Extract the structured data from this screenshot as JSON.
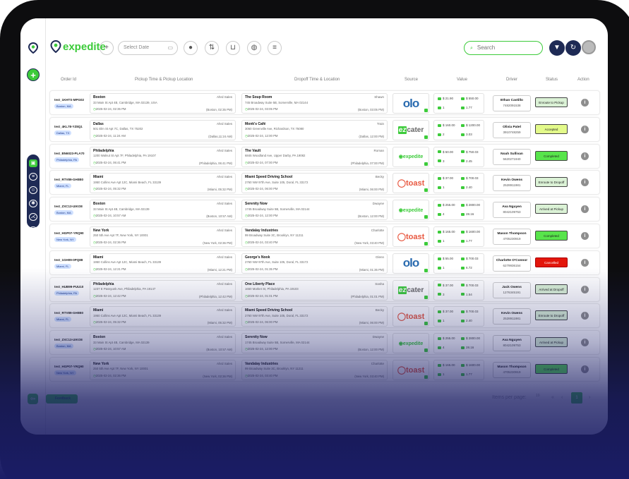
{
  "brand": {
    "name": "expedite"
  },
  "toolbar": {
    "date_placeholder": "Select Date",
    "search_placeholder": "Search"
  },
  "columns": [
    "Order Id",
    "Pickup Time & Pickup Location",
    "Dropoff Time & Location",
    "Source",
    "Value",
    "Driver",
    "Status",
    "Action"
  ],
  "orders": [
    {
      "order_id": "test_1KHTS-MPG02",
      "city": "Boston, MA",
      "pickup": {
        "name": "Boston",
        "who": "Ahrd Sales",
        "address": "33 Main St Apt 4B, Cambridge, MA 02139, USA",
        "time": "2025-02-24, 02:35 PM",
        "local": "(Boston, 02:35 PM)"
      },
      "dropoff": {
        "name": "The Soup Room",
        "who": "Shawn",
        "address": "745 Broadway Suite 5B, Somerville, MA 02144",
        "time": "2025-02-24, 03:05 PM",
        "local": "(Boston, 03:05 PM)"
      },
      "source": "olo",
      "value": {
        "a": "$ 21.90",
        "b": "$ 550.00",
        "c": "1",
        "d": "1.77"
      },
      "driver": {
        "name": "Ethan Castillo",
        "phone": "7482091538"
      },
      "status": "Enroute to Pickup",
      "status_class": "st-enroute"
    },
    {
      "order_id": "test_4KL78-YZ8Q1",
      "city": "Dallas, TX",
      "pickup": {
        "name": "Dallas",
        "who": "Ahrd Sales",
        "address": "501 Elm St Apt 7C, Dallas, TX 75202",
        "time": "2025-02-24, 11:24 AM",
        "local": "(Dallas,11:24 AM)"
      },
      "dropoff": {
        "name": "Monk's Café",
        "who": "Train",
        "address": "3060 Greenville Ave, Richardson, TX 75080",
        "time": "2025-02-24, 12:00 PM",
        "local": "(Dallas, 12:00 PM)"
      },
      "source": "ezcater",
      "value": {
        "a": "$ 160.00",
        "b": "$ 1200.00",
        "c": "2",
        "d": "3.03"
      },
      "driver": {
        "name": "Olivia Patel",
        "phone": "3910748259"
      },
      "status": "Accepted",
      "status_class": "st-accepted"
    },
    {
      "order_id": "test_BN6023-PLA70",
      "city": "Philadelphia, PA",
      "pickup": {
        "name": "Philadelphia",
        "who": "Ahrd Sales",
        "address": "1200 Walnut St Apt 7F, Philadelphia, PA 19107",
        "time": "2025-02-24, 06:41 PM",
        "local": "(Philadelphia, 06:41 PM)"
      },
      "dropoff": {
        "name": "The Vault",
        "who": "Roman",
        "address": "6845 Woodland Ave, Upper Darby, PA 19082",
        "time": "2025-02-24, 07:00 PM",
        "local": "(Philadelphia, 07:00 PM)"
      },
      "source": "expedite",
      "value": {
        "a": "$ 50.00",
        "b": "$ 750.03",
        "c": "3",
        "d": "2.45"
      },
      "driver": {
        "name": "Noah Sullivan",
        "phone": "5620271940"
      },
      "status": "Completed",
      "status_class": "st-completed"
    },
    {
      "order_id": "test_RTV89-GH0B0",
      "city": "Miami, FL",
      "pickup": {
        "name": "Miami",
        "who": "Ahrd Sales",
        "address": "1950 Collins Ave Apt 12C, Miami Beach, FL 33139",
        "time": "2025-02-24, 05:32 PM",
        "local": "(Miami, 05:32 PM)"
      },
      "dropoff": {
        "name": "Miami Speed Driving School",
        "who": "Becky",
        "address": "2760 NW 97th Ave, Suite 105, Doral, FL 33172",
        "time": "2025-02-24, 06:00 PM",
        "local": "(Miami, 06:00 PM)"
      },
      "source": "toast",
      "value": {
        "a": "$ 37.00",
        "b": "$ 700.03",
        "c": "1",
        "d": "2.40"
      },
      "driver": {
        "name": "Kevin Owens",
        "phone": "2528911981"
      },
      "status": "Enroute to Dropoff",
      "status_class": "st-enroute"
    },
    {
      "order_id": "test_ZXC13-UIKO8",
      "city": "Boston, MA",
      "pickup": {
        "name": "Boston",
        "who": "Ahrd Sales",
        "address": "33 Main St Apt 4B, Cambridge, MA 02139",
        "time": "2025-02-24, 10:57 AM",
        "local": "(Boston, 10:57 AM)"
      },
      "dropoff": {
        "name": "Serenity Now",
        "who": "Dwayne",
        "address": "1745 Broadway Suite 5B, Somerville, MA 02144",
        "time": "2025-02-24, 12:00 PM",
        "local": "(Boston, 12:00 PM)"
      },
      "source": "expedite",
      "value": {
        "a": "$ 255.00",
        "b": "$ 2800.00",
        "c": "4",
        "d": "28.16"
      },
      "driver": {
        "name": "Ava Nguyen",
        "phone": "8042109753"
      },
      "status": "Arrived at Pickup",
      "status_class": "st-arrived"
    },
    {
      "order_id": "test_HGP07-YRQ90",
      "city": "New York, NY",
      "pickup": {
        "name": "New York",
        "who": "Ahrd Sales",
        "address": "250 5th Ave Apt 7F, New York, NY 10001",
        "time": "2025-02-24, 02:36 PM",
        "local": "(New York, 02:36 PM)"
      },
      "dropoff": {
        "name": "Vandalay Industries",
        "who": "Charlotte",
        "address": "99 Broadway Suite 3C, Brooklyn, NY 11211",
        "time": "2025-02-24, 03:40 PM",
        "local": "(New York, 03:40 PM)"
      },
      "source": "toast",
      "value": {
        "a": "$ 165.00",
        "b": "$ 1600.00",
        "c": "1",
        "d": "1.77"
      },
      "driver": {
        "name": "Mason Thompson",
        "phone": "4705230919"
      },
      "status": "Completed",
      "status_class": "st-completed"
    },
    {
      "order_id": "test_1GH09-0PQ88",
      "city": "Miami, FL",
      "pickup": {
        "name": "Miami",
        "who": "Ahrd Sales",
        "address": "1950 Collins Ave Apt 12C, Miami Beach, FL 33139",
        "time": "2025-02-24, 12:21 PM",
        "local": "(Miami, 12:21 PM)"
      },
      "dropoff": {
        "name": "George's Nook",
        "who": "Glenn",
        "address": "2760 NW 97th Ave, Suite 105, Doral, FL 33172",
        "time": "2025-02-24, 01:35 PM",
        "local": "(Miami, 01:35 PM)"
      },
      "source": "olo",
      "value": {
        "a": "$ 55.00",
        "b": "$ 700.03",
        "c": "1",
        "d": "6.72"
      },
      "driver": {
        "name": "Charlotte O'Connor",
        "phone": "6279936154"
      },
      "status": "Cancelled",
      "status_class": "st-cancelled"
    },
    {
      "order_id": "test_HUB99-PUU10",
      "city": "Philadelphia, PA",
      "pickup": {
        "name": "Philadelphia",
        "who": "Ahrd Sales",
        "address": "1237 E Passyunk Ave, Philadelphia, PA 19147",
        "time": "2025-02-24, 12:42 PM",
        "local": "(Philadelphia, 12:42 PM)"
      },
      "dropoff": {
        "name": "One Liberty Place",
        "who": "Sasha",
        "address": "1650 Market St, Philadelphia, PA 19103",
        "time": "2025-02-24, 01:01 PM",
        "local": "(Philadelphia, 01:01 PM)"
      },
      "source": "ezcater",
      "value": {
        "a": "$ 37.00",
        "b": "$ 700.03",
        "c": "3",
        "d": "1.54"
      },
      "driver": {
        "name": "Jack Owens",
        "phone": "1276345191"
      },
      "status": "Arrived at Dropoff",
      "status_class": "st-arrived"
    },
    {
      "order_id": "test_RTV89-GH0B0",
      "city": "Miami, FL",
      "pickup": {
        "name": "Miami",
        "who": "Ahrd Sales",
        "address": "1950 Collins Ave Apt 12C, Miami Beach, FL 33139",
        "time": "2025-02-24, 05:32 PM",
        "local": "(Miami, 05:32 PM)"
      },
      "dropoff": {
        "name": "Miami Speed Driving School",
        "who": "Becky",
        "address": "2760 NW 97th Ave, Suite 105, Doral, FL 33172",
        "time": "2025-02-24, 06:00 PM",
        "local": "(Miami, 06:00 PM)"
      },
      "source": "toast",
      "value": {
        "a": "$ 37.00",
        "b": "$ 700.03",
        "c": "1",
        "d": "2.40"
      },
      "driver": {
        "name": "Kevin Owens",
        "phone": "2528911981"
      },
      "status": "Enroute to Dropoff",
      "status_class": "st-enroute"
    },
    {
      "order_id": "test_ZXC13-UIKO8",
      "city": "Boston, MA",
      "pickup": {
        "name": "Boston",
        "who": "Ahrd Sales",
        "address": "33 Main St Apt 4B, Cambridge, MA 02139",
        "time": "2025-02-24, 10:57 AM",
        "local": "(Boston, 10:57 AM)"
      },
      "dropoff": {
        "name": "Serenity Now",
        "who": "Dwayne",
        "address": "1745 Broadway Suite 5B, Somerville, MA 02144",
        "time": "2025-02-24, 12:00 PM",
        "local": "(Boston, 12:00 PM)"
      },
      "source": "expedite",
      "value": {
        "a": "$ 255.00",
        "b": "$ 2800.00",
        "c": "4",
        "d": "28.16"
      },
      "driver": {
        "name": "Ava Nguyen",
        "phone": "8042109753"
      },
      "status": "Arrived at Pickup",
      "status_class": "st-arrived"
    },
    {
      "order_id": "test_HGP07-YRQ90",
      "city": "New York, NY",
      "pickup": {
        "name": "New York",
        "who": "Ahrd Sales",
        "address": "250 5th Ave Apt 7F, New York, NY 10001",
        "time": "2025-02-24, 02:36 PM",
        "local": "(New York, 02:36 PM)"
      },
      "dropoff": {
        "name": "Vandalay Industries",
        "who": "Charlotte",
        "address": "99 Broadway Suite 3C, Brooklyn, NY 11211",
        "time": "2025-02-24, 03:40 PM",
        "local": "(New York, 03:40 PM)"
      },
      "source": "toast",
      "value": {
        "a": "$ 165.00",
        "b": "$ 1600.00",
        "c": "1",
        "d": "1.77"
      },
      "driver": {
        "name": "Mason Thompson",
        "phone": "4705230919"
      },
      "status": "Completed",
      "status_class": "st-completed"
    }
  ],
  "footer": {
    "feedback": "Feedback",
    "items_per_page_label": "Items per page:",
    "items_per_page": "10",
    "prev_first": "«",
    "prev": "‹",
    "page": "1",
    "next": "›"
  },
  "colors": {
    "accent": "#3ccb3a",
    "navy": "#1e2a55",
    "cancelled": "#e3160b",
    "completed": "#58e44b",
    "accepted": "#e3fa8a"
  }
}
